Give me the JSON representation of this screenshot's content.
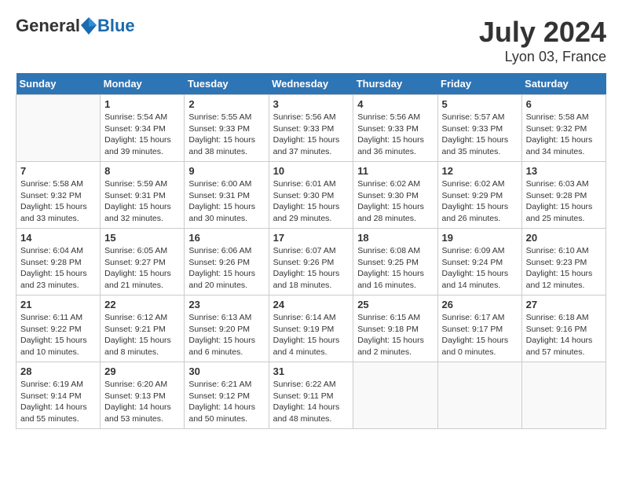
{
  "header": {
    "logo_general": "General",
    "logo_blue": "Blue",
    "month_title": "July 2024",
    "location": "Lyon 03, France"
  },
  "calendar": {
    "days_of_week": [
      "Sunday",
      "Monday",
      "Tuesday",
      "Wednesday",
      "Thursday",
      "Friday",
      "Saturday"
    ],
    "weeks": [
      [
        {
          "day": "",
          "sunrise": "",
          "sunset": "",
          "daylight": ""
        },
        {
          "day": "1",
          "sunrise": "Sunrise: 5:54 AM",
          "sunset": "Sunset: 9:34 PM",
          "daylight": "Daylight: 15 hours and 39 minutes."
        },
        {
          "day": "2",
          "sunrise": "Sunrise: 5:55 AM",
          "sunset": "Sunset: 9:33 PM",
          "daylight": "Daylight: 15 hours and 38 minutes."
        },
        {
          "day": "3",
          "sunrise": "Sunrise: 5:56 AM",
          "sunset": "Sunset: 9:33 PM",
          "daylight": "Daylight: 15 hours and 37 minutes."
        },
        {
          "day": "4",
          "sunrise": "Sunrise: 5:56 AM",
          "sunset": "Sunset: 9:33 PM",
          "daylight": "Daylight: 15 hours and 36 minutes."
        },
        {
          "day": "5",
          "sunrise": "Sunrise: 5:57 AM",
          "sunset": "Sunset: 9:33 PM",
          "daylight": "Daylight: 15 hours and 35 minutes."
        },
        {
          "day": "6",
          "sunrise": "Sunrise: 5:58 AM",
          "sunset": "Sunset: 9:32 PM",
          "daylight": "Daylight: 15 hours and 34 minutes."
        }
      ],
      [
        {
          "day": "7",
          "sunrise": "Sunrise: 5:58 AM",
          "sunset": "Sunset: 9:32 PM",
          "daylight": "Daylight: 15 hours and 33 minutes."
        },
        {
          "day": "8",
          "sunrise": "Sunrise: 5:59 AM",
          "sunset": "Sunset: 9:31 PM",
          "daylight": "Daylight: 15 hours and 32 minutes."
        },
        {
          "day": "9",
          "sunrise": "Sunrise: 6:00 AM",
          "sunset": "Sunset: 9:31 PM",
          "daylight": "Daylight: 15 hours and 30 minutes."
        },
        {
          "day": "10",
          "sunrise": "Sunrise: 6:01 AM",
          "sunset": "Sunset: 9:30 PM",
          "daylight": "Daylight: 15 hours and 29 minutes."
        },
        {
          "day": "11",
          "sunrise": "Sunrise: 6:02 AM",
          "sunset": "Sunset: 9:30 PM",
          "daylight": "Daylight: 15 hours and 28 minutes."
        },
        {
          "day": "12",
          "sunrise": "Sunrise: 6:02 AM",
          "sunset": "Sunset: 9:29 PM",
          "daylight": "Daylight: 15 hours and 26 minutes."
        },
        {
          "day": "13",
          "sunrise": "Sunrise: 6:03 AM",
          "sunset": "Sunset: 9:28 PM",
          "daylight": "Daylight: 15 hours and 25 minutes."
        }
      ],
      [
        {
          "day": "14",
          "sunrise": "Sunrise: 6:04 AM",
          "sunset": "Sunset: 9:28 PM",
          "daylight": "Daylight: 15 hours and 23 minutes."
        },
        {
          "day": "15",
          "sunrise": "Sunrise: 6:05 AM",
          "sunset": "Sunset: 9:27 PM",
          "daylight": "Daylight: 15 hours and 21 minutes."
        },
        {
          "day": "16",
          "sunrise": "Sunrise: 6:06 AM",
          "sunset": "Sunset: 9:26 PM",
          "daylight": "Daylight: 15 hours and 20 minutes."
        },
        {
          "day": "17",
          "sunrise": "Sunrise: 6:07 AM",
          "sunset": "Sunset: 9:26 PM",
          "daylight": "Daylight: 15 hours and 18 minutes."
        },
        {
          "day": "18",
          "sunrise": "Sunrise: 6:08 AM",
          "sunset": "Sunset: 9:25 PM",
          "daylight": "Daylight: 15 hours and 16 minutes."
        },
        {
          "day": "19",
          "sunrise": "Sunrise: 6:09 AM",
          "sunset": "Sunset: 9:24 PM",
          "daylight": "Daylight: 15 hours and 14 minutes."
        },
        {
          "day": "20",
          "sunrise": "Sunrise: 6:10 AM",
          "sunset": "Sunset: 9:23 PM",
          "daylight": "Daylight: 15 hours and 12 minutes."
        }
      ],
      [
        {
          "day": "21",
          "sunrise": "Sunrise: 6:11 AM",
          "sunset": "Sunset: 9:22 PM",
          "daylight": "Daylight: 15 hours and 10 minutes."
        },
        {
          "day": "22",
          "sunrise": "Sunrise: 6:12 AM",
          "sunset": "Sunset: 9:21 PM",
          "daylight": "Daylight: 15 hours and 8 minutes."
        },
        {
          "day": "23",
          "sunrise": "Sunrise: 6:13 AM",
          "sunset": "Sunset: 9:20 PM",
          "daylight": "Daylight: 15 hours and 6 minutes."
        },
        {
          "day": "24",
          "sunrise": "Sunrise: 6:14 AM",
          "sunset": "Sunset: 9:19 PM",
          "daylight": "Daylight: 15 hours and 4 minutes."
        },
        {
          "day": "25",
          "sunrise": "Sunrise: 6:15 AM",
          "sunset": "Sunset: 9:18 PM",
          "daylight": "Daylight: 15 hours and 2 minutes."
        },
        {
          "day": "26",
          "sunrise": "Sunrise: 6:17 AM",
          "sunset": "Sunset: 9:17 PM",
          "daylight": "Daylight: 15 hours and 0 minutes."
        },
        {
          "day": "27",
          "sunrise": "Sunrise: 6:18 AM",
          "sunset": "Sunset: 9:16 PM",
          "daylight": "Daylight: 14 hours and 57 minutes."
        }
      ],
      [
        {
          "day": "28",
          "sunrise": "Sunrise: 6:19 AM",
          "sunset": "Sunset: 9:14 PM",
          "daylight": "Daylight: 14 hours and 55 minutes."
        },
        {
          "day": "29",
          "sunrise": "Sunrise: 6:20 AM",
          "sunset": "Sunset: 9:13 PM",
          "daylight": "Daylight: 14 hours and 53 minutes."
        },
        {
          "day": "30",
          "sunrise": "Sunrise: 6:21 AM",
          "sunset": "Sunset: 9:12 PM",
          "daylight": "Daylight: 14 hours and 50 minutes."
        },
        {
          "day": "31",
          "sunrise": "Sunrise: 6:22 AM",
          "sunset": "Sunset: 9:11 PM",
          "daylight": "Daylight: 14 hours and 48 minutes."
        },
        {
          "day": "",
          "sunrise": "",
          "sunset": "",
          "daylight": ""
        },
        {
          "day": "",
          "sunrise": "",
          "sunset": "",
          "daylight": ""
        },
        {
          "day": "",
          "sunrise": "",
          "sunset": "",
          "daylight": ""
        }
      ]
    ]
  }
}
